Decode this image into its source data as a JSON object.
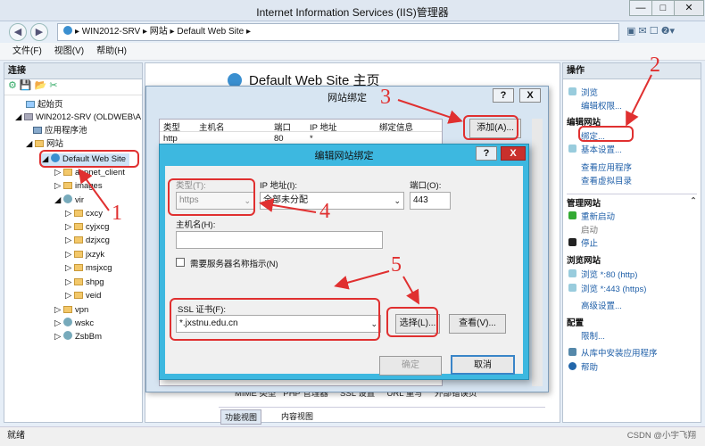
{
  "window": {
    "title": "Internet Information Services (IIS)管理器",
    "min": "—",
    "max": "□",
    "close": "✕"
  },
  "address": {
    "back": "◀",
    "fwd": "▶",
    "path": "▸ WIN2012-SRV ▸ 网站 ▸ Default Web Site ▸"
  },
  "menu": [
    "文件(F)",
    "视图(V)",
    "帮助(H)"
  ],
  "left": {
    "title": "连接",
    "tree": [
      "起始页",
      "WIN2012-SRV (OLDWEB\\A",
      "应用程序池",
      "网站",
      "Default Web Site",
      "aspnet_client",
      "images",
      "vir",
      "cxcy",
      "cyjxcg",
      "dzjxcg",
      "jxzyk",
      "msjxcg",
      "shpg",
      "veid",
      "vpn",
      "wskc",
      "ZsbBm"
    ]
  },
  "center": {
    "title": "Default Web Site 主页",
    "tabs": [
      "功能视图",
      "内容视图"
    ],
    "bottom_cols": "MIME 类型   PHP 管理器     SSL 设置     URL 重写     外部错误页"
  },
  "right": {
    "title": "操作",
    "a1": "浏览",
    "a2": "编辑权限...",
    "s1": "编辑网站",
    "a3": "绑定...",
    "a4": "基本设置...",
    "a5": "查看应用程序",
    "a6": "查看虚拟目录",
    "s2": "管理网站",
    "a7": "重新启动",
    "a8": "启动",
    "a9": "停止",
    "s3": "浏览网站",
    "a10": "浏览 *:80 (http)",
    "a11": "浏览 *:443 (https)",
    "a12": "高级设置...",
    "s4": "配置",
    "a13": "限制...",
    "a14": "从库中安装应用程序",
    "a15": "帮助"
  },
  "dialog1": {
    "title": "网站绑定",
    "help": "?",
    "close": "X",
    "cols": [
      "类型",
      "主机名",
      "端口",
      "IP 地址",
      "绑定信息"
    ],
    "row": [
      "http",
      "",
      "80",
      "*",
      ""
    ],
    "add": "添加(A)..."
  },
  "dialog2": {
    "title": "编辑网站绑定",
    "help": "?",
    "close": "X",
    "type_label": "类型(T):",
    "type_value": "https",
    "ip_label": "IP 地址(I):",
    "ip_value": "全部未分配",
    "port_label": "端口(O):",
    "port_value": "443",
    "host_label": "主机名(H):",
    "host_value": "",
    "sni_label": "需要服务器名称指示(N)",
    "ssl_label": "SSL 证书(F):",
    "ssl_value": "*.jxstnu.edu.cn",
    "select": "选择(L)...",
    "view": "查看(V)...",
    "ok": "确定",
    "cancel": "取消"
  },
  "annotations": [
    "1",
    "3",
    "4",
    "5",
    "2"
  ],
  "status": "就绪",
  "watermark": "CSDN @小宇飞翔"
}
